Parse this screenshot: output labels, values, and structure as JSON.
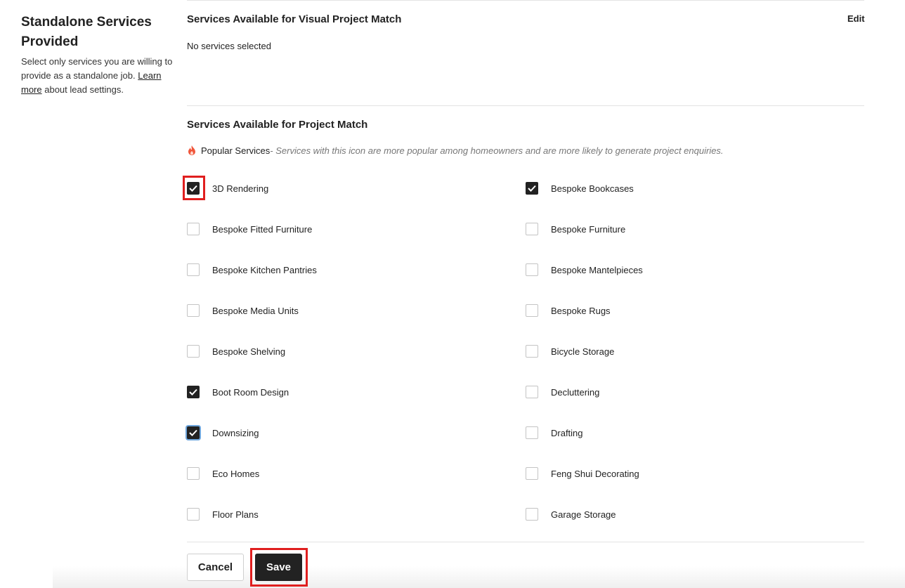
{
  "sidebar": {
    "title": "Standalone Services Provided",
    "description": "Select only services you are willing to provide as a standalone job.",
    "learn_more": "Learn more",
    "learn_more_suffix": " about lead settings."
  },
  "visual_match": {
    "title": "Services Available for Visual Project Match",
    "edit_label": "Edit",
    "empty_text": "No services selected"
  },
  "project_match": {
    "title": "Services Available for Project Match",
    "popular_label": "Popular Services",
    "popular_note": "- Services with this icon are more popular among homeowners and are more likely to generate project enquiries.",
    "services": [
      {
        "label": "3D Rendering",
        "checked": true
      },
      {
        "label": "Bespoke Bookcases",
        "checked": true
      },
      {
        "label": "Bespoke Fitted Furniture",
        "checked": false
      },
      {
        "label": "Bespoke Furniture",
        "checked": false
      },
      {
        "label": "Bespoke Kitchen Pantries",
        "checked": false
      },
      {
        "label": "Bespoke Mantelpieces",
        "checked": false
      },
      {
        "label": "Bespoke Media Units",
        "checked": false
      },
      {
        "label": "Bespoke Rugs",
        "checked": false
      },
      {
        "label": "Bespoke Shelving",
        "checked": false
      },
      {
        "label": "Bicycle Storage",
        "checked": false
      },
      {
        "label": "Boot Room Design",
        "checked": true
      },
      {
        "label": "Decluttering",
        "checked": false
      },
      {
        "label": "Downsizing",
        "checked": true
      },
      {
        "label": "Drafting",
        "checked": false
      },
      {
        "label": "Eco Homes",
        "checked": false
      },
      {
        "label": "Feng Shui Decorating",
        "checked": false
      },
      {
        "label": "Floor Plans",
        "checked": false
      },
      {
        "label": "Garage Storage",
        "checked": false
      }
    ]
  },
  "actions": {
    "cancel_label": "Cancel",
    "save_label": "Save"
  },
  "colors": {
    "highlight": "#e01f1f",
    "flame": "#f0563b",
    "checked": "#222222"
  }
}
